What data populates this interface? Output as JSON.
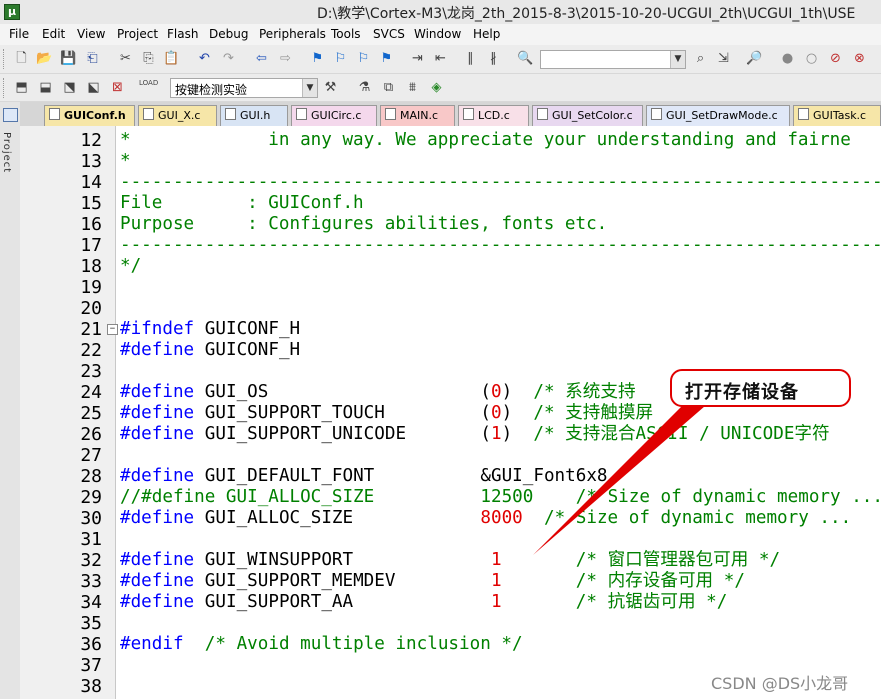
{
  "window": {
    "title": "D:\\教学\\Cortex-M3\\龙岗_2th_2015-8-3\\2015-10-20-UCGUI_2th\\UCGUI_1th\\USE",
    "app_icon": "μ"
  },
  "menu": [
    "File",
    "Edit",
    "View",
    "Project",
    "Flash",
    "Debug",
    "Peripherals",
    "Tools",
    "SVCS",
    "Window",
    "Help"
  ],
  "toolbar1": {
    "icons": [
      "new-file-icon",
      "open-folder-icon",
      "save-icon",
      "save-all-icon",
      "cut-icon",
      "copy-icon",
      "paste-icon",
      "undo-icon",
      "redo-icon",
      "back-arrow-icon",
      "forward-arrow-icon",
      "bookmark-icon",
      "prev-bookmark-icon",
      "next-bookmark-icon",
      "clear-bookmarks-icon",
      "indent-icon",
      "unindent-icon",
      "comment-icon",
      "uncomment-icon",
      "find-in-files-icon",
      "find-icon",
      "incremental-find-icon",
      "zoom-icon",
      "debug-start-icon",
      "breakpoint-icon",
      "disable-breakpoints-icon",
      "kill-breakpoints-icon"
    ],
    "search_value": ""
  },
  "toolbar2": {
    "target_label": "按键检测实验",
    "icons": [
      "translate-icon",
      "build-icon",
      "rebuild-icon",
      "batch-build-icon",
      "stop-build-icon",
      "load-icon",
      "target-options-icon",
      "manage-components-icon",
      "copy-target-icon",
      "pack-installer-icon"
    ],
    "load_text": "LOAD"
  },
  "tabs": [
    {
      "label": "GUIConf.h",
      "color": "#f6e6a8",
      "active": true
    },
    {
      "label": "GUI_X.c",
      "color": "#f6e6a8",
      "active": false
    },
    {
      "label": "GUI.h",
      "color": "#d8e4f4",
      "active": false
    },
    {
      "label": "GUICirc.c",
      "color": "#f4d8ec",
      "active": false
    },
    {
      "label": "MAIN.c",
      "color": "#f8c8c8",
      "active": false
    },
    {
      "label": "LCD.c",
      "color": "#f8e0e8",
      "active": false
    },
    {
      "label": "GUI_SetColor.c",
      "color": "#e8d8f0",
      "active": false
    },
    {
      "label": "GUI_SetDrawMode.c",
      "color": "#e0e8f8",
      "active": false
    },
    {
      "label": "GUITask.c",
      "color": "#f6e6a8",
      "active": false
    }
  ],
  "sidebar": {
    "label": "Project"
  },
  "editor": {
    "lines": [
      {
        "n": "12",
        "segs": [
          {
            "t": "*             in any way. We appreciate your understanding and fairne",
            "c": "c-comment"
          }
        ]
      },
      {
        "n": "13",
        "segs": [
          {
            "t": "*",
            "c": "c-comment"
          }
        ]
      },
      {
        "n": "14",
        "segs": [
          {
            "t": "------------------------------------------------------------------------",
            "c": "c-comment"
          }
        ]
      },
      {
        "n": "15",
        "segs": [
          {
            "t": "File        : GUIConf.h",
            "c": "c-comment"
          }
        ]
      },
      {
        "n": "16",
        "segs": [
          {
            "t": "Purpose     : Configures abilities, fonts etc.",
            "c": "c-comment"
          }
        ]
      },
      {
        "n": "17",
        "segs": [
          {
            "t": "------------------------------------------------------------------------",
            "c": "c-comment"
          }
        ]
      },
      {
        "n": "18",
        "segs": [
          {
            "t": "*/",
            "c": "c-comment"
          }
        ]
      },
      {
        "n": "19",
        "segs": []
      },
      {
        "n": "20",
        "segs": []
      },
      {
        "n": "21",
        "fold": "−",
        "segs": [
          {
            "t": "#ifndef ",
            "c": "c-pre"
          },
          {
            "t": "GUICONF_H",
            "c": "c-text",
            "col": 8
          }
        ]
      },
      {
        "n": "22",
        "segs": [
          {
            "t": "#define ",
            "c": "c-pre"
          },
          {
            "t": "GUICONF_H",
            "c": "c-text",
            "col": 8
          }
        ]
      },
      {
        "n": "23",
        "segs": []
      },
      {
        "n": "24",
        "segs": [
          {
            "t": "#define ",
            "c": "c-pre"
          },
          {
            "t": "GUI_OS",
            "c": "c-text",
            "col": 8
          },
          {
            "t": "(",
            "c": "c-text",
            "col": 34
          },
          {
            "t": "0",
            "c": "c-num",
            "col": 35
          },
          {
            "t": ")",
            "c": "c-text",
            "col": 36
          },
          {
            "t": "/* 系统支持",
            "c": "c-comment",
            "col": 39
          }
        ]
      },
      {
        "n": "25",
        "segs": [
          {
            "t": "#define ",
            "c": "c-pre"
          },
          {
            "t": "GUI_SUPPORT_TOUCH",
            "c": "c-text",
            "col": 8
          },
          {
            "t": "(",
            "c": "c-text",
            "col": 34
          },
          {
            "t": "0",
            "c": "c-num",
            "col": 35
          },
          {
            "t": ")",
            "c": "c-text",
            "col": 36
          },
          {
            "t": "/* 支持触摸屏",
            "c": "c-comment",
            "col": 39
          }
        ]
      },
      {
        "n": "26",
        "segs": [
          {
            "t": "#define ",
            "c": "c-pre"
          },
          {
            "t": "GUI_SUPPORT_UNICODE",
            "c": "c-text",
            "col": 8
          },
          {
            "t": "(",
            "c": "c-text",
            "col": 34
          },
          {
            "t": "1",
            "c": "c-num",
            "col": 35
          },
          {
            "t": ")",
            "c": "c-text",
            "col": 36
          },
          {
            "t": "/* 支持混合ASCII / UNICODE字符",
            "c": "c-comment",
            "col": 39
          }
        ]
      },
      {
        "n": "27",
        "segs": []
      },
      {
        "n": "28",
        "segs": [
          {
            "t": "#define ",
            "c": "c-pre"
          },
          {
            "t": "GUI_DEFAULT_FONT",
            "c": "c-text",
            "col": 8
          },
          {
            "t": "&GUI_Font6x8",
            "c": "c-text",
            "col": 34
          }
        ]
      },
      {
        "n": "29",
        "segs": [
          {
            "t": "//#define GUI_ALLOC_SIZE",
            "c": "c-comment"
          },
          {
            "t": "12500",
            "c": "c-comment",
            "col": 34
          },
          {
            "t": "/* Size of dynamic memory ...",
            "c": "c-comment",
            "col": 43
          }
        ]
      },
      {
        "n": "30",
        "segs": [
          {
            "t": "#define ",
            "c": "c-pre"
          },
          {
            "t": "GUI_ALLOC_SIZE",
            "c": "c-text",
            "col": 8
          },
          {
            "t": "8000",
            "c": "c-num",
            "col": 34
          },
          {
            "t": "/* Size of dynamic memory ...",
            "c": "c-comment",
            "col": 40
          }
        ]
      },
      {
        "n": "31",
        "segs": []
      },
      {
        "n": "32",
        "segs": [
          {
            "t": "#define ",
            "c": "c-pre"
          },
          {
            "t": "GUI_WINSUPPORT",
            "c": "c-text",
            "col": 8
          },
          {
            "t": "1",
            "c": "c-num",
            "col": 35
          },
          {
            "t": "/* 窗口管理器包可用 */",
            "c": "c-comment",
            "col": 43
          }
        ]
      },
      {
        "n": "33",
        "segs": [
          {
            "t": "#define ",
            "c": "c-pre"
          },
          {
            "t": "GUI_SUPPORT_MEMDEV",
            "c": "c-text",
            "col": 8
          },
          {
            "t": "1",
            "c": "c-num",
            "col": 35
          },
          {
            "t": "/* 内存设备可用 */",
            "c": "c-comment",
            "col": 43
          }
        ]
      },
      {
        "n": "34",
        "segs": [
          {
            "t": "#define ",
            "c": "c-pre"
          },
          {
            "t": "GUI_SUPPORT_AA",
            "c": "c-text",
            "col": 8
          },
          {
            "t": "1",
            "c": "c-num",
            "col": 35
          },
          {
            "t": "/* 抗锯齿可用 */",
            "c": "c-comment",
            "col": 43
          }
        ]
      },
      {
        "n": "35",
        "segs": []
      },
      {
        "n": "36",
        "segs": [
          {
            "t": "#endif  ",
            "c": "c-pre"
          },
          {
            "t": "/* Avoid multiple inclusion */",
            "c": "c-comment",
            "col": 8
          }
        ]
      },
      {
        "n": "37",
        "segs": []
      },
      {
        "n": "38",
        "segs": []
      }
    ]
  },
  "annotation": {
    "text": "打开存储设备",
    "color": "#e00000"
  },
  "watermark": "CSDN @DS小龙哥",
  "colors": {
    "comment": "#008000",
    "preprocessor": "#0000ff",
    "number": "#e00000",
    "annotation": "#e00000"
  }
}
